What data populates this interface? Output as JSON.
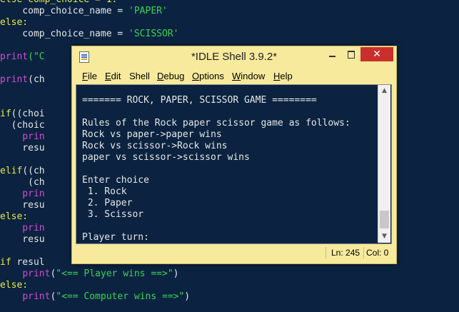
{
  "editor": {
    "lines": [
      [
        {
          "t": "else comp_choice = 1:",
          "c": "kw"
        }
      ],
      [
        {
          "t": "    comp_choice_name = ",
          "c": "pl"
        },
        {
          "t": "'PAPER'",
          "c": "str"
        }
      ],
      [
        {
          "t": "else:",
          "c": "kw"
        }
      ],
      [
        {
          "t": "    comp_choice_name = ",
          "c": "pl"
        },
        {
          "t": "'SCISSOR'",
          "c": "str"
        }
      ],
      [
        {
          "t": "",
          "c": "pl"
        }
      ],
      [
        {
          "t": "print",
          "c": "fn"
        },
        {
          "t": "(\"C",
          "c": "str"
        }
      ],
      [
        {
          "t": "",
          "c": "pl"
        }
      ],
      [
        {
          "t": "print",
          "c": "fn"
        },
        {
          "t": "(ch",
          "c": "pl"
        }
      ],
      [
        {
          "t": "",
          "c": "pl"
        }
      ],
      [
        {
          "t": "",
          "c": "pl"
        }
      ],
      [
        {
          "t": "if",
          "c": "kw"
        },
        {
          "t": "((choi",
          "c": "pl"
        }
      ],
      [
        {
          "t": "  (choic",
          "c": "pl"
        }
      ],
      [
        {
          "t": "    prin",
          "c": "fn"
        }
      ],
      [
        {
          "t": "    resu",
          "c": "pl"
        }
      ],
      [
        {
          "t": "",
          "c": "pl"
        }
      ],
      [
        {
          "t": "elif",
          "c": "kw"
        },
        {
          "t": "((ch",
          "c": "pl"
        }
      ],
      [
        {
          "t": "     (ch",
          "c": "pl"
        }
      ],
      [
        {
          "t": "    prin",
          "c": "fn"
        }
      ],
      [
        {
          "t": "    resu",
          "c": "pl"
        }
      ],
      [
        {
          "t": "else:",
          "c": "kw"
        }
      ],
      [
        {
          "t": "    prin",
          "c": "fn"
        }
      ],
      [
        {
          "t": "    resu",
          "c": "pl"
        }
      ],
      [
        {
          "t": "",
          "c": "pl"
        }
      ],
      [
        {
          "t": "if",
          "c": "kw"
        },
        {
          "t": " resul",
          "c": "pl"
        }
      ],
      [
        {
          "t": "    ",
          "c": "pl"
        },
        {
          "t": "print",
          "c": "fn"
        },
        {
          "t": "(",
          "c": "pl"
        },
        {
          "t": "\"<== Player wins ==>\"",
          "c": "str"
        },
        {
          "t": ")",
          "c": "pl"
        }
      ],
      [
        {
          "t": "else:",
          "c": "kw"
        }
      ],
      [
        {
          "t": "    ",
          "c": "pl"
        },
        {
          "t": "print",
          "c": "fn"
        },
        {
          "t": "(",
          "c": "pl"
        },
        {
          "t": "\"<== Computer wins ==>\"",
          "c": "str"
        },
        {
          "t": ")",
          "c": "pl"
        }
      ]
    ]
  },
  "window": {
    "title": "*IDLE Shell 3.9.2*",
    "close_glyph": "✕",
    "menu": [
      {
        "label": "File",
        "ul": "F",
        "rest": "ile"
      },
      {
        "label": "Edit",
        "ul": "E",
        "rest": "dit"
      },
      {
        "label": "Shell",
        "ul": "",
        "rest": "Shell"
      },
      {
        "label": "Debug",
        "ul": "D",
        "rest": "ebug"
      },
      {
        "label": "Options",
        "ul": "O",
        "rest": "ptions"
      },
      {
        "label": "Window",
        "ul": "W",
        "rest": "indow"
      },
      {
        "label": "Help",
        "ul": "H",
        "rest": "elp"
      }
    ],
    "shell_lines": [
      "======= ROCK, PAPER, SCISSOR GAME ========",
      "",
      "Rules of the Rock paper scissor game as follows:",
      "Rock vs paper->paper wins",
      "Rock vs scissor->Rock wins",
      "paper vs scissor->scissor wins",
      "",
      "Enter choice",
      " 1. Rock",
      " 2. Paper",
      " 3. Scissor",
      "",
      "Player turn:"
    ],
    "status": {
      "ln": "Ln: 245",
      "col": "Col: 0"
    }
  },
  "colors": {
    "editor_bg": "#0b2340",
    "idle_chrome": "#f7ea9c",
    "close_red": "#c9302c",
    "keyword": "#e8e84a",
    "builtin": "#d44bd4",
    "string": "#39d353"
  }
}
